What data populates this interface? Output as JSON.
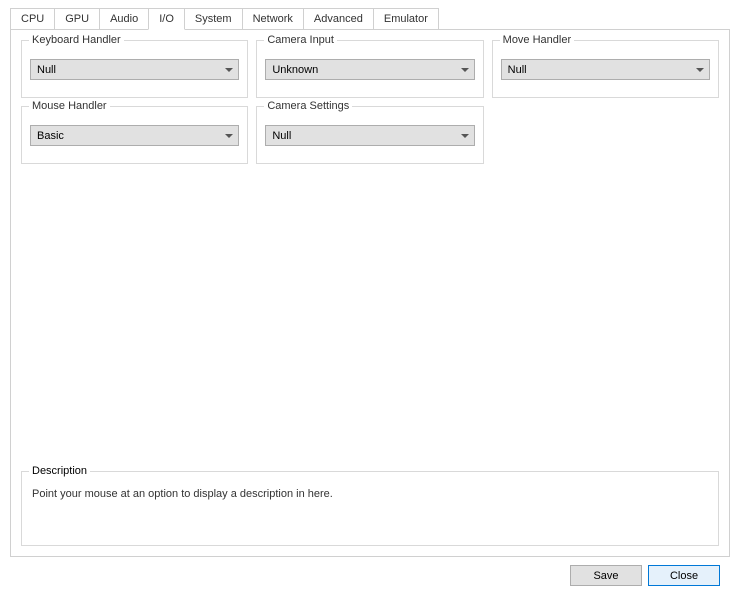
{
  "tabs": {
    "items": [
      {
        "label": "CPU"
      },
      {
        "label": "GPU"
      },
      {
        "label": "Audio"
      },
      {
        "label": "I/O"
      },
      {
        "label": "System"
      },
      {
        "label": "Network"
      },
      {
        "label": "Advanced"
      },
      {
        "label": "Emulator"
      }
    ],
    "active_index": 3
  },
  "settings": {
    "keyboard_handler": {
      "label": "Keyboard Handler",
      "value": "Null"
    },
    "camera_input": {
      "label": "Camera Input",
      "value": "Unknown"
    },
    "move_handler": {
      "label": "Move Handler",
      "value": "Null"
    },
    "mouse_handler": {
      "label": "Mouse Handler",
      "value": "Basic"
    },
    "camera_settings": {
      "label": "Camera Settings",
      "value": "Null"
    }
  },
  "description": {
    "label": "Description",
    "text": "Point your mouse at an option to display a description in here."
  },
  "footer": {
    "save_label": "Save",
    "close_label": "Close"
  }
}
